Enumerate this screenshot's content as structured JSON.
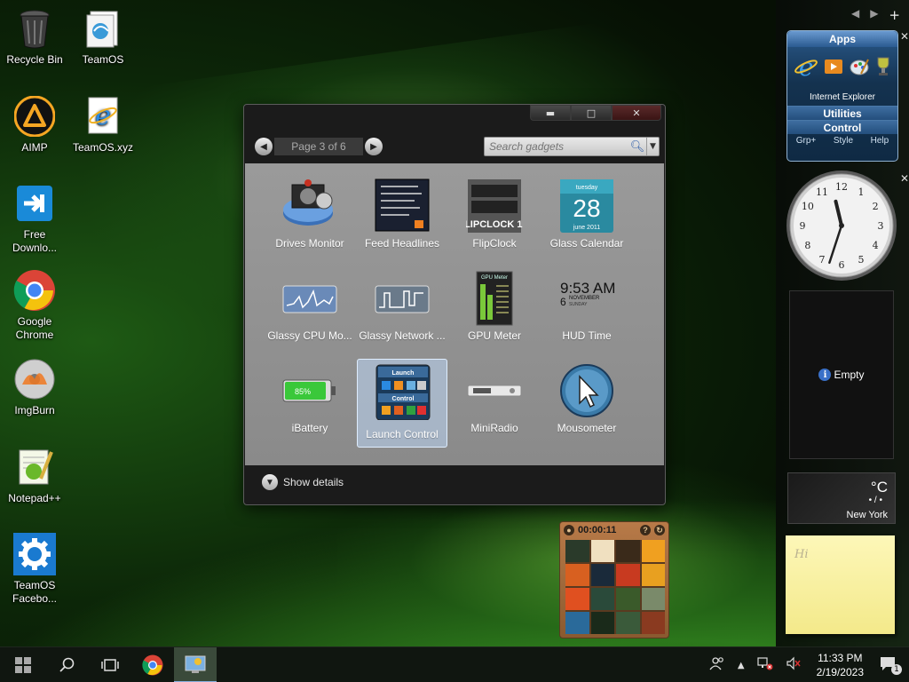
{
  "desktop_icons": [
    {
      "label": "Recycle Bin",
      "icon": "recycle-bin-icon"
    },
    {
      "label": "TeamOS",
      "icon": "folder-icon"
    },
    {
      "label": "AIMP",
      "icon": "aimp-icon"
    },
    {
      "label": "TeamOS.xyz",
      "icon": "ie-shortcut-icon"
    },
    {
      "label": "Free\nDownlo...",
      "icon": "free-download-icon"
    },
    {
      "label": "Google\nChrome",
      "icon": "chrome-icon"
    },
    {
      "label": "ImgBurn",
      "icon": "imgburn-icon"
    },
    {
      "label": "Notepad++",
      "icon": "notepadpp-icon"
    },
    {
      "label": "TeamOS\nFacebo...",
      "icon": "settings-gear-icon"
    }
  ],
  "gallery": {
    "page_text": "Page 3 of 6",
    "search_placeholder": "Search gadgets",
    "show_details": "Show details",
    "gadgets": [
      {
        "name": "Drives Monitor",
        "icon": "drives-monitor-icon"
      },
      {
        "name": "Feed Headlines",
        "icon": "feed-headlines-icon"
      },
      {
        "name": "FlipClock",
        "icon": "flipclock-icon",
        "text": "FLIPCLOCK 1.0"
      },
      {
        "name": "Glass Calendar",
        "icon": "glass-calendar-icon",
        "day": "28",
        "weekday": "tuesday",
        "month": "june 2011"
      },
      {
        "name": "Glassy CPU Mo...",
        "icon": "cpu-monitor-icon"
      },
      {
        "name": "Glassy Network ...",
        "icon": "network-monitor-icon"
      },
      {
        "name": "GPU Meter",
        "icon": "gpu-meter-icon",
        "text": "GPU Meter"
      },
      {
        "name": "HUD Time",
        "icon": "hud-time-icon",
        "time": "9:53 AM",
        "date_num": "6",
        "date_month": "NOVEMBER",
        "date_day": "SUNDAY"
      },
      {
        "name": "iBattery",
        "icon": "battery-icon",
        "percent": "85%"
      },
      {
        "name": "Launch Control",
        "icon": "launch-control-icon",
        "selected": true,
        "top": "Launch",
        "mid": "Control"
      },
      {
        "name": "MiniRadio",
        "icon": "mini-radio-icon"
      },
      {
        "name": "Mousometer",
        "icon": "mousometer-icon"
      }
    ]
  },
  "sidebar": {
    "apps_title": "Apps",
    "apps_hover": "Internet Explorer",
    "utilities": "Utilities",
    "control": "Control",
    "footer": [
      "Grp+",
      "Style",
      "Help"
    ],
    "empty_label": "Empty",
    "weather_deg": "°C",
    "weather_dots": "• / •",
    "weather_city": "New York",
    "note_text": "Hi"
  },
  "clock": {
    "hour": 11,
    "minute": 33,
    "numerals": [
      "12",
      "1",
      "2",
      "3",
      "4",
      "5",
      "6",
      "7",
      "8",
      "9",
      "10",
      "11"
    ]
  },
  "puzzle": {
    "timer": "00:00:11"
  },
  "taskbar": {
    "time": "11:33 PM",
    "date": "2/19/2023",
    "notif_count": "1"
  },
  "colors": {
    "accent": "#8ab0e0",
    "sidebar_apps": "#2a5a8c"
  }
}
